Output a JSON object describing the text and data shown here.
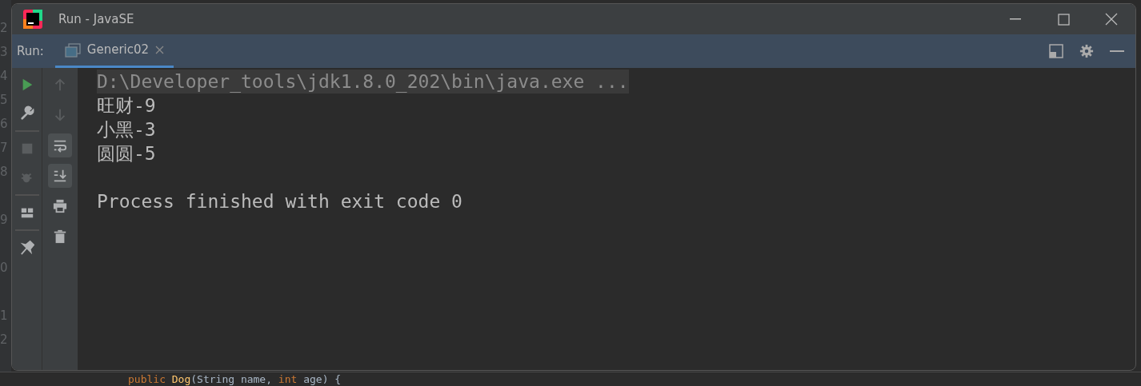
{
  "editor": {
    "line_numbers": [
      {
        "text": "2",
        "folded_above": false
      },
      {
        "text": "3",
        "folded_above": false
      },
      {
        "text": "4",
        "folded_above": false
      },
      {
        "text": "5",
        "folded_above": false
      },
      {
        "text": "6",
        "folded_above": false
      },
      {
        "text": "7",
        "folded_above": false
      },
      {
        "text": "8",
        "folded_above": false
      },
      {
        "text": "9",
        "folded_above": true
      },
      {
        "text": "0",
        "folded_above": true
      },
      {
        "text": "1",
        "folded_above": true
      },
      {
        "text": "2",
        "folded_above": false
      }
    ],
    "code_line": [
      {
        "text": "public",
        "kind": "keyword"
      },
      {
        "text": "Dog",
        "kind": "method"
      },
      {
        "text": "(String name,",
        "kind": "plain"
      },
      {
        "text": "int",
        "kind": "keyword"
      },
      {
        "text": "age) {",
        "kind": "plain"
      }
    ]
  },
  "window": {
    "title": "Run - JavaSE"
  },
  "run_bar": {
    "label": "Run:",
    "tabs": [
      {
        "label": "Generic02",
        "selected": true
      }
    ]
  },
  "left_toolbar": [
    {
      "kind": "run",
      "enabled": true
    },
    {
      "kind": "wrench",
      "enabled": true
    },
    {
      "kind": "separator"
    },
    {
      "kind": "stop",
      "enabled": false
    },
    {
      "kind": "bug",
      "enabled": false
    },
    {
      "kind": "separator"
    },
    {
      "kind": "layout",
      "enabled": true
    },
    {
      "kind": "separator"
    },
    {
      "kind": "pin",
      "enabled": true
    }
  ],
  "console_toolbar": [
    {
      "kind": "up",
      "enabled": false,
      "on": false
    },
    {
      "kind": "down",
      "enabled": false,
      "on": false
    },
    {
      "kind": "wrap",
      "enabled": true,
      "on": true
    },
    {
      "kind": "scroll-end",
      "enabled": true,
      "on": true
    },
    {
      "kind": "print",
      "enabled": true,
      "on": false
    },
    {
      "kind": "trash",
      "enabled": true,
      "on": false
    }
  ],
  "console": [
    {
      "kind": "command",
      "text": "D:\\Developer_tools\\jdk1.8.0_202\\bin\\java.exe ..."
    },
    {
      "kind": "output",
      "text": "旺财-9"
    },
    {
      "kind": "output",
      "text": "小黑-3"
    },
    {
      "kind": "output",
      "text": "圆圆-5"
    },
    {
      "kind": "blank"
    },
    {
      "kind": "output",
      "text": "Process finished with exit code 0"
    }
  ]
}
